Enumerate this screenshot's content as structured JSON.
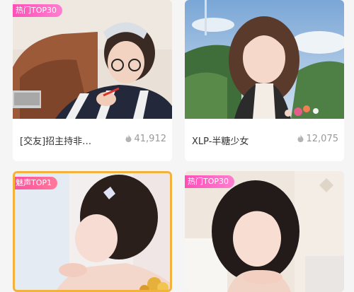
{
  "cards": [
    {
      "badge": "热门TOP30",
      "title": "[交友]招主持非…",
      "heat": "41,912"
    },
    {
      "badge": "",
      "title": "XLP-半糖少女",
      "heat": "12,075"
    },
    {
      "badge": "魅声TOP1",
      "title": "",
      "heat": ""
    },
    {
      "badge": "热门TOP30",
      "title": "",
      "heat": ""
    }
  ],
  "colors": {
    "badge_pink": "#ff5cc0",
    "gold_frame": "#f3b23b",
    "heat_text": "#999999"
  },
  "icons": {
    "heat": "flame-icon"
  }
}
